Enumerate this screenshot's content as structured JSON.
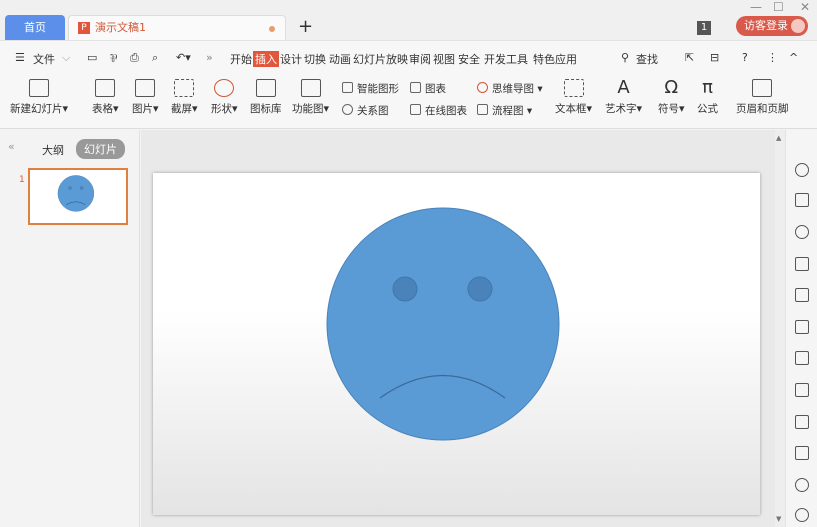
{
  "tabs": {
    "home": "首页",
    "doc": "演示文稿1",
    "new": "+"
  },
  "window": {
    "min": "—",
    "max": "☐",
    "close": "✕",
    "badge": "1",
    "login": "访客登录"
  },
  "menu": {
    "file": "文件",
    "more": "»",
    "tabs": [
      "开始",
      "插入",
      "设计",
      "切换",
      "动画",
      "幻灯片放映",
      "审阅",
      "视图",
      "安全",
      "开发工具",
      "特色应用"
    ],
    "active": "插入",
    "search": "查找",
    "help": "?",
    "dots": "⋮",
    "collapse": "^"
  },
  "ribbon": {
    "big": [
      "新建幻灯片",
      "表格",
      "图片",
      "截屏",
      "形状",
      "图标库",
      "功能图",
      "文本框",
      "艺术字",
      "符号",
      "公式",
      "页眉和页脚"
    ],
    "small": [
      "智能图形",
      "关系图",
      "图表",
      "在线图表",
      "思维导图",
      "流程图"
    ]
  },
  "panel": {
    "outline": "大纲",
    "slides": "幻灯片",
    "slide_number": "1"
  },
  "colors": {
    "accent": "#e2573b",
    "face": "#5b9bd5",
    "eyes": "#4a83ba"
  }
}
